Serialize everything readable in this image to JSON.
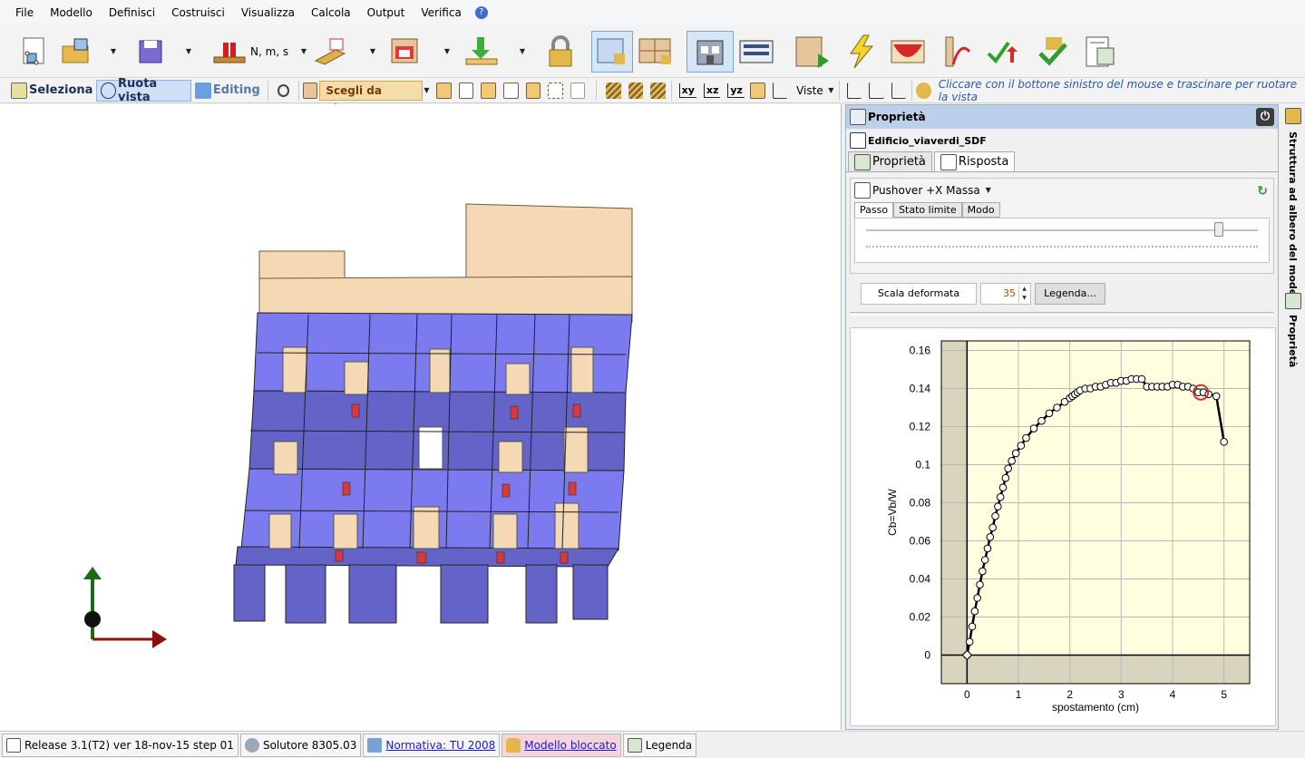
{
  "menu": [
    "File",
    "Modello",
    "Definisci",
    "Costruisci",
    "Visualizza",
    "Calcola",
    "Output",
    "Verifica"
  ],
  "toolbar": {
    "units_label": "N, m, s",
    "icons": [
      "new-model-icon",
      "open-folder-icon",
      "save-icon",
      "units-icon",
      "beam-icon",
      "wall-icon",
      "load-icon",
      "lock-icon",
      "locked-section-icon",
      "locked-panel-icon",
      "building-view-icon",
      "layers-view-icon",
      "run-analysis-icon",
      "lightning-icon",
      "pushover-icon",
      "curve-icon",
      "verify-red-icon",
      "verify-green-icon",
      "report-icon"
    ]
  },
  "toolbar2": {
    "seleziona": "Seleziona",
    "ruota_vista": "Ruota vista",
    "editing": "Editing",
    "scegli": "Scegli da pianta",
    "axes": [
      "xy",
      "xz",
      "yz"
    ],
    "viste": "Viste",
    "hint": "Cliccare con il bottone sinistro del mouse e trascinare per ruotare la vista"
  },
  "panel": {
    "title": "Proprietà",
    "model_name": "Edificio_viaverdi_SDF",
    "tabs": [
      "Proprietà",
      "Risposta"
    ],
    "analysis": "Pushover +X Massa",
    "subtabs": [
      "Passo",
      "Stato limite",
      "Modo"
    ],
    "slider_fraction": 0.9,
    "scala_label": "Scala deformata",
    "scala_value": "35",
    "legenda_label": "Legenda..."
  },
  "side_tabs": [
    "Struttura ad albero del modello",
    "Proprietà"
  ],
  "status": {
    "release": "Release 3.1(T2) ver 18-nov-15 step 01",
    "solutore": "Solutore 8305.03",
    "normativa": "Normativa: TU 2008",
    "bloccato": "Modello bloccato",
    "legenda": "Legenda"
  },
  "chart_data": {
    "type": "line",
    "xlabel": "spostamento (cm)",
    "ylabel": "Cb=Vb/W",
    "xlim": [
      -0.5,
      5.5
    ],
    "ylim": [
      -0.015,
      0.165
    ],
    "xticks": [
      0,
      1,
      2,
      3,
      4,
      5
    ],
    "yticks": [
      0,
      0.02,
      0.04,
      0.06,
      0.08,
      0.1,
      0.12,
      0.14,
      0.16
    ],
    "ytick_labels": [
      "0",
      "0.02",
      "0.04",
      "0.06",
      "0.08",
      "0.1",
      "0.12",
      "0.14",
      "0.16"
    ],
    "grid": true,
    "series": [
      {
        "x": [
          0,
          0.05,
          0.1,
          0.15,
          0.2,
          0.25,
          0.3,
          0.35,
          0.4,
          0.45,
          0.5,
          0.55,
          0.6,
          0.65,
          0.7,
          0.75,
          0.8,
          0.87,
          0.95,
          1.05,
          1.15,
          1.3,
          1.45,
          1.6,
          1.75,
          1.9,
          2.0,
          2.05,
          2.1,
          2.15,
          2.2,
          2.3,
          2.4,
          2.5,
          2.6,
          2.7,
          2.8,
          2.9,
          3.0,
          3.1,
          3.2,
          3.3,
          3.4,
          3.5,
          3.6,
          3.7,
          3.8,
          3.9,
          4.0,
          4.1,
          4.2,
          4.3,
          4.4,
          4.5,
          4.6,
          4.7,
          4.85,
          5.0
        ],
        "values": [
          0,
          0.007,
          0.015,
          0.023,
          0.03,
          0.037,
          0.044,
          0.05,
          0.056,
          0.062,
          0.067,
          0.073,
          0.078,
          0.083,
          0.088,
          0.093,
          0.098,
          0.102,
          0.106,
          0.11,
          0.114,
          0.119,
          0.123,
          0.127,
          0.13,
          0.133,
          0.135,
          0.136,
          0.137,
          0.138,
          0.139,
          0.14,
          0.14,
          0.141,
          0.141,
          0.142,
          0.143,
          0.143,
          0.144,
          0.144,
          0.145,
          0.145,
          0.145,
          0.141,
          0.141,
          0.141,
          0.141,
          0.141,
          0.142,
          0.142,
          0.141,
          0.141,
          0.14,
          0.138,
          0.138,
          0.137,
          0.136,
          0.112
        ]
      }
    ],
    "highlight_point": {
      "x": 4.55,
      "y": 0.138
    },
    "colors": {
      "plot_bg": "#ffffe0",
      "outer_bg": "#d8d4be",
      "line": "#000000",
      "marker": "#ffffff",
      "highlight": "#cc3333"
    }
  }
}
